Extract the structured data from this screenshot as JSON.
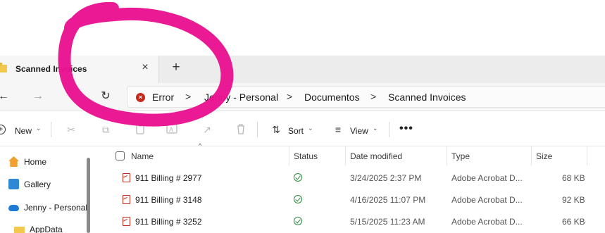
{
  "tab": {
    "title": "Scanned Invoices",
    "close_icon": "×",
    "new_tab_icon": "+"
  },
  "nav": {
    "back_icon": "←",
    "forward_icon": "→",
    "up_icon": "↑",
    "refresh_icon": "↻"
  },
  "breadcrumb": {
    "items": [
      "Error",
      "Jenny - Personal",
      "Documentos",
      "Scanned Invoices"
    ],
    "separator": ">",
    "error_icon": "×"
  },
  "toolbar": {
    "new_label": "New",
    "new_icon": "+",
    "sort_label": "Sort",
    "view_label": "View",
    "more_label": "•••",
    "cut_icon": "✂",
    "copy_icon": "⧉",
    "paste_icon": "📋",
    "rename_icon": "A",
    "share_icon": "↗",
    "delete_icon": "🗑",
    "sort_icon": "⇅",
    "view_icon": "≡",
    "chevron": "⌄"
  },
  "sidebar": {
    "items": [
      {
        "label": "Home",
        "icon": "home-icon"
      },
      {
        "label": "Gallery",
        "icon": "gallery-icon"
      },
      {
        "label": "Jenny - Personal",
        "icon": "onedrive-cloud-icon"
      },
      {
        "label": "AppData",
        "icon": "folder-icon"
      }
    ]
  },
  "columns": {
    "name": "Name",
    "status": "Status",
    "date_modified": "Date modified",
    "type": "Type",
    "size": "Size",
    "sort_caret": "^"
  },
  "files": [
    {
      "name": "911 Billing # 2977",
      "date": "3/24/2025 2:37 PM",
      "type": "Adobe Acrobat D...",
      "size": "68 KB"
    },
    {
      "name": "911 Billing # 3148",
      "date": "4/16/2025 11:07 PM",
      "type": "Adobe Acrobat D...",
      "size": "92 KB"
    },
    {
      "name": "911 Billing # 3252",
      "date": "5/15/2025 11:23 AM",
      "type": "Adobe Acrobat D...",
      "size": "66 KB"
    }
  ],
  "colors": {
    "annotation": "#e8138f",
    "error": "#c42b1c",
    "status_ok": "#2a8a3a"
  }
}
